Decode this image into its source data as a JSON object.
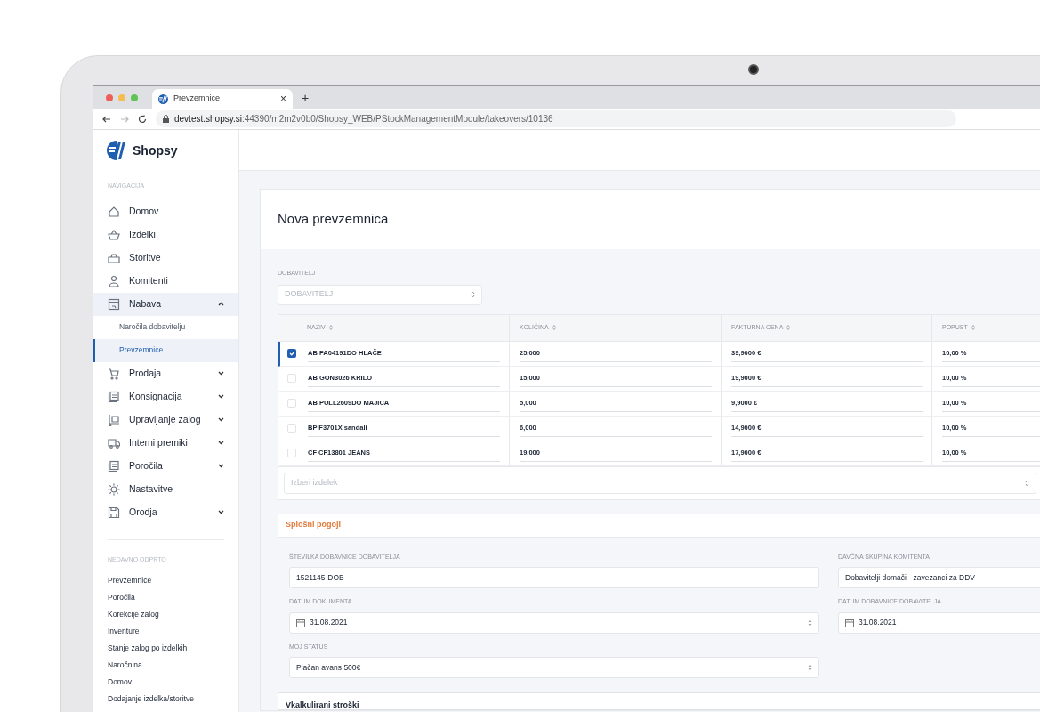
{
  "browser": {
    "tab_title": "Prevzemnice",
    "tab_close": "×",
    "new_tab": "+",
    "url": "**devtest.shopsy.si**:44390/m2m2v0b0/Shopsy_WEB/PStockManagementModule/takeovers/10136"
  },
  "sidebar": {
    "logo": "Shopsy",
    "nav_heading": "NAVIGACIJA",
    "items": [
      {
        "kind": "home",
        "label": "Domov"
      },
      {
        "kind": "basket",
        "label": "Izdelki"
      },
      {
        "kind": "bag",
        "label": "Storitve"
      },
      {
        "kind": "user",
        "label": "Komitenti"
      },
      {
        "kind": "inbox",
        "label": "Nabava",
        "expanded": true,
        "children": [
          {
            "label": "Naročila dobavitelju",
            "selected": false
          },
          {
            "label": "Prevzemnice",
            "selected": true
          }
        ]
      },
      {
        "kind": "cart",
        "label": "Prodaja",
        "expanded": false
      },
      {
        "kind": "stack",
        "label": "Konsignacija",
        "expanded": false
      },
      {
        "kind": "dolly",
        "label": "Upravljanje zalog",
        "expanded": false
      },
      {
        "kind": "truck",
        "label": "Interni premiki",
        "expanded": false
      },
      {
        "kind": "stack",
        "label": "Poročila",
        "expanded": false
      },
      {
        "kind": "gear",
        "label": "Nastavitve"
      },
      {
        "kind": "floppy",
        "label": "Orodja",
        "expanded": false
      }
    ],
    "recent_heading": "NEDAVNO ODPRTO",
    "recent": [
      "Prevzemnice",
      "Poročila",
      "Korekcije zalog",
      "Inventure",
      "Stanje zalog po izdelkih",
      "Naročnina",
      "Domov",
      "Dodajanje izdelka/storitve"
    ]
  },
  "page": {
    "title": "Nova prevzemnica",
    "supplier": {
      "label": "DOBAVITELJ",
      "placeholder": "DOBAVITELJ"
    },
    "table": {
      "columns": [
        "NAZIV",
        "KOLIČINA",
        "FAKTURNA CENA",
        "POPUST"
      ],
      "rows": [
        {
          "selected": true,
          "cells": [
            "AB PA04191DO HLAČE",
            "25,000",
            "39,9000 €",
            "10,00 %"
          ]
        },
        {
          "selected": false,
          "cells": [
            "AB GON3026 KRILO",
            "15,000",
            "19,9000 €",
            "10,00 %"
          ]
        },
        {
          "selected": false,
          "cells": [
            "AB PULL2609DO MAJICA",
            "5,000",
            "9,9000 €",
            "10,00 %"
          ]
        },
        {
          "selected": false,
          "cells": [
            "BP F3701X sandali",
            "6,000",
            "14,9000 €",
            "10,00 %"
          ]
        },
        {
          "selected": false,
          "cells": [
            "CF CF13801 JEANS",
            "19,000",
            "17,9000 €",
            "10,00 %"
          ]
        }
      ],
      "add_placeholder": "Izberi izdelek"
    },
    "section": {
      "title": "Splošni pogoji",
      "fields": [
        {
          "kind": "text",
          "label": "ŠTEVILKA DOBAVNICE DOBAVITELJA",
          "value": "1521145-DOB"
        },
        {
          "kind": "text",
          "label": "DAVČNA SKUPINA KOMITENTA",
          "value": "Dobavitelji domači - zavezanci za DDV"
        },
        {
          "kind": "date",
          "label": "DATUM DOKUMENTA",
          "value": "31.08.2021"
        },
        {
          "kind": "date",
          "label": "DATUM DOBAVNICE DOBAVITELJA",
          "value": "31.08.2021"
        },
        {
          "kind": "select",
          "label": "MOJ STATUS",
          "value": "Plačan avans 500€"
        }
      ]
    },
    "next_section": "Vkalkulirani stroški"
  }
}
